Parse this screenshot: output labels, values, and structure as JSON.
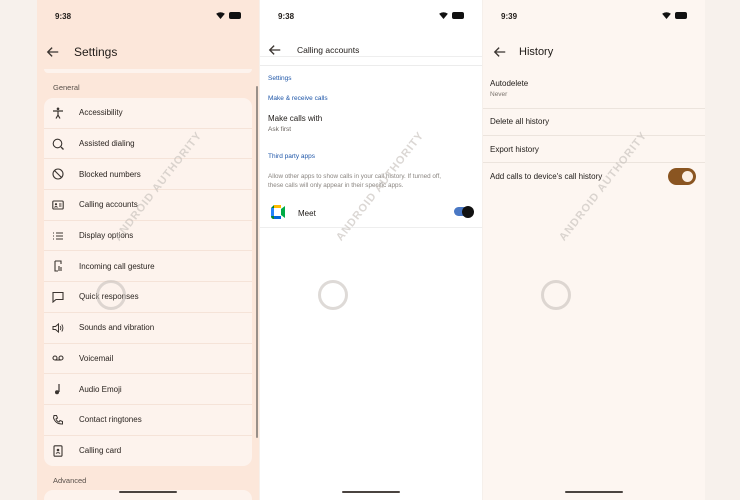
{
  "panel1": {
    "time": "9:38",
    "title": "Settings",
    "general_label": "General",
    "advanced_label": "Advanced",
    "items": [
      {
        "label": "Accessibility",
        "icon": "accessibility-icon"
      },
      {
        "label": "Assisted dialing",
        "icon": "assisted-dialing-icon"
      },
      {
        "label": "Blocked numbers",
        "icon": "block-icon"
      },
      {
        "label": "Calling accounts",
        "icon": "calling-accounts-icon"
      },
      {
        "label": "Display options",
        "icon": "list-icon"
      },
      {
        "label": "Incoming call gesture",
        "icon": "gesture-icon"
      },
      {
        "label": "Quick responses",
        "icon": "message-icon"
      },
      {
        "label": "Sounds and vibration",
        "icon": "volume-icon"
      },
      {
        "label": "Voicemail",
        "icon": "voicemail-icon"
      },
      {
        "label": "Audio Emoji",
        "icon": "music-note-icon"
      },
      {
        "label": "Contact ringtones",
        "icon": "phone-icon"
      },
      {
        "label": "Calling card",
        "icon": "calling-card-icon"
      }
    ]
  },
  "panel2": {
    "time": "9:38",
    "title": "Calling accounts",
    "settings_label": "Settings",
    "make_receive_label": "Make & receive calls",
    "make_calls_with": "Make calls with",
    "make_calls_with_value": "Ask first",
    "third_party_label": "Third party apps",
    "third_party_desc": "Allow other apps to show calls in your call history. If turned off, these calls will only appear in their specific apps.",
    "meet_label": "Meet",
    "meet_enabled": true
  },
  "panel3": {
    "time": "9:39",
    "title": "History",
    "autodelete_label": "Autodelete",
    "autodelete_value": "Never",
    "delete_all_label": "Delete all history",
    "export_label": "Export history",
    "add_calls_label": "Add calls to device's call history",
    "add_calls_enabled": true
  },
  "watermark": "ANDROID AUTHORITY",
  "colors": {
    "accent_blue": "#1e56a8",
    "toggle_brown": "#8a5521",
    "panel1_bg": "#fce7da"
  }
}
